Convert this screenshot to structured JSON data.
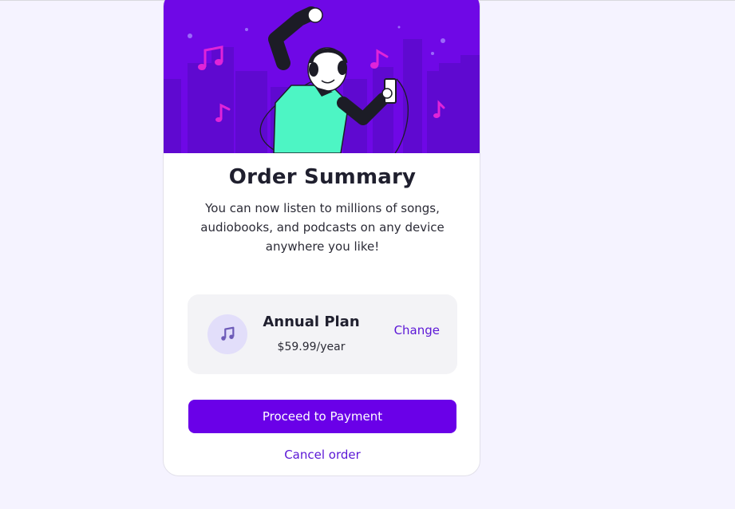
{
  "colors": {
    "hero_background": "#6f08e6",
    "accent": "#6a00e8",
    "link": "#5b16d6",
    "page_background": "#f5f3ff"
  },
  "hero": {
    "image": "person-listening-music-illustration"
  },
  "order": {
    "title": "Order Summary",
    "description": "You can now listen to millions of songs, audiobooks, and podcasts on any device anywhere you like!"
  },
  "plan": {
    "icon": "music-note-icon",
    "name": "Annual Plan",
    "price": "$59.99/year",
    "change_label": "Change"
  },
  "actions": {
    "proceed_label": "Proceed to Payment",
    "cancel_label": "Cancel order"
  }
}
